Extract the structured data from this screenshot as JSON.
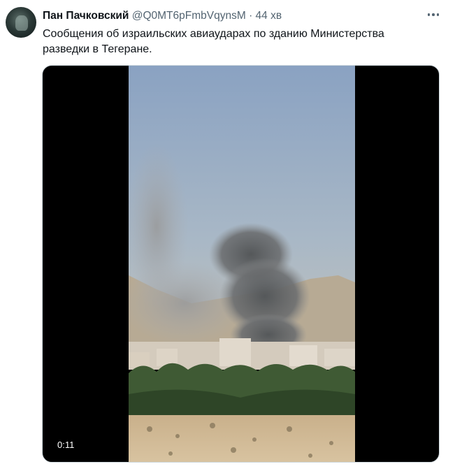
{
  "tweet": {
    "author_name": "Пан Пачковский",
    "handle": "@Q0MT6pFmbVqynsM",
    "separator": "·",
    "time": "44 хв",
    "text": "Сообщения об израильских авиаударах по зданию Министерства разведки в Тегеране.",
    "more_icon": "more-horizontal-icon",
    "avatar_icon": "avatar"
  },
  "media": {
    "duration": "0:11"
  },
  "colors": {
    "text_primary": "#0f1419",
    "text_secondary": "#536471",
    "media_background": "#000000"
  }
}
